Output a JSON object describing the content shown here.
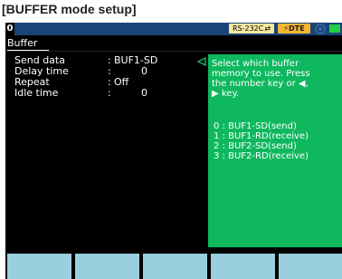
{
  "caption": "[BUFFER mode setup]",
  "topbar": {
    "channel": "0",
    "interface": "RS-232C",
    "mode_badge": "DTE"
  },
  "tab": {
    "label": "Buffer"
  },
  "settings": [
    {
      "label": "Send data",
      "colon": ":",
      "value": "BUF1-SD"
    },
    {
      "label": "Delay time",
      "colon": ":",
      "value": "0"
    },
    {
      "label": "Repeat",
      "colon": ":",
      "value": "Off"
    },
    {
      "label": "Idle time",
      "colon": ":",
      "value": "0"
    }
  ],
  "help": {
    "message_lines": [
      "Select which buffer",
      "memory to use. Press",
      "the number key or ◀,",
      "▶ key."
    ],
    "options": [
      "0 : BUF1-SD(send)",
      "1 : BUF1-RD(receive)",
      "2 : BUF2-SD(send)",
      "3 : BUF2-RD(receive)"
    ]
  },
  "function_keys": [
    "",
    "",
    "",
    "",
    ""
  ],
  "colors": {
    "screen_bg": "#000000",
    "help_panel": "#0fb85e",
    "fkey": "#9ad0de",
    "topbar": "#1a4478",
    "dte_badge": "#f2b632",
    "rs_badge": "#f5e8a0"
  }
}
